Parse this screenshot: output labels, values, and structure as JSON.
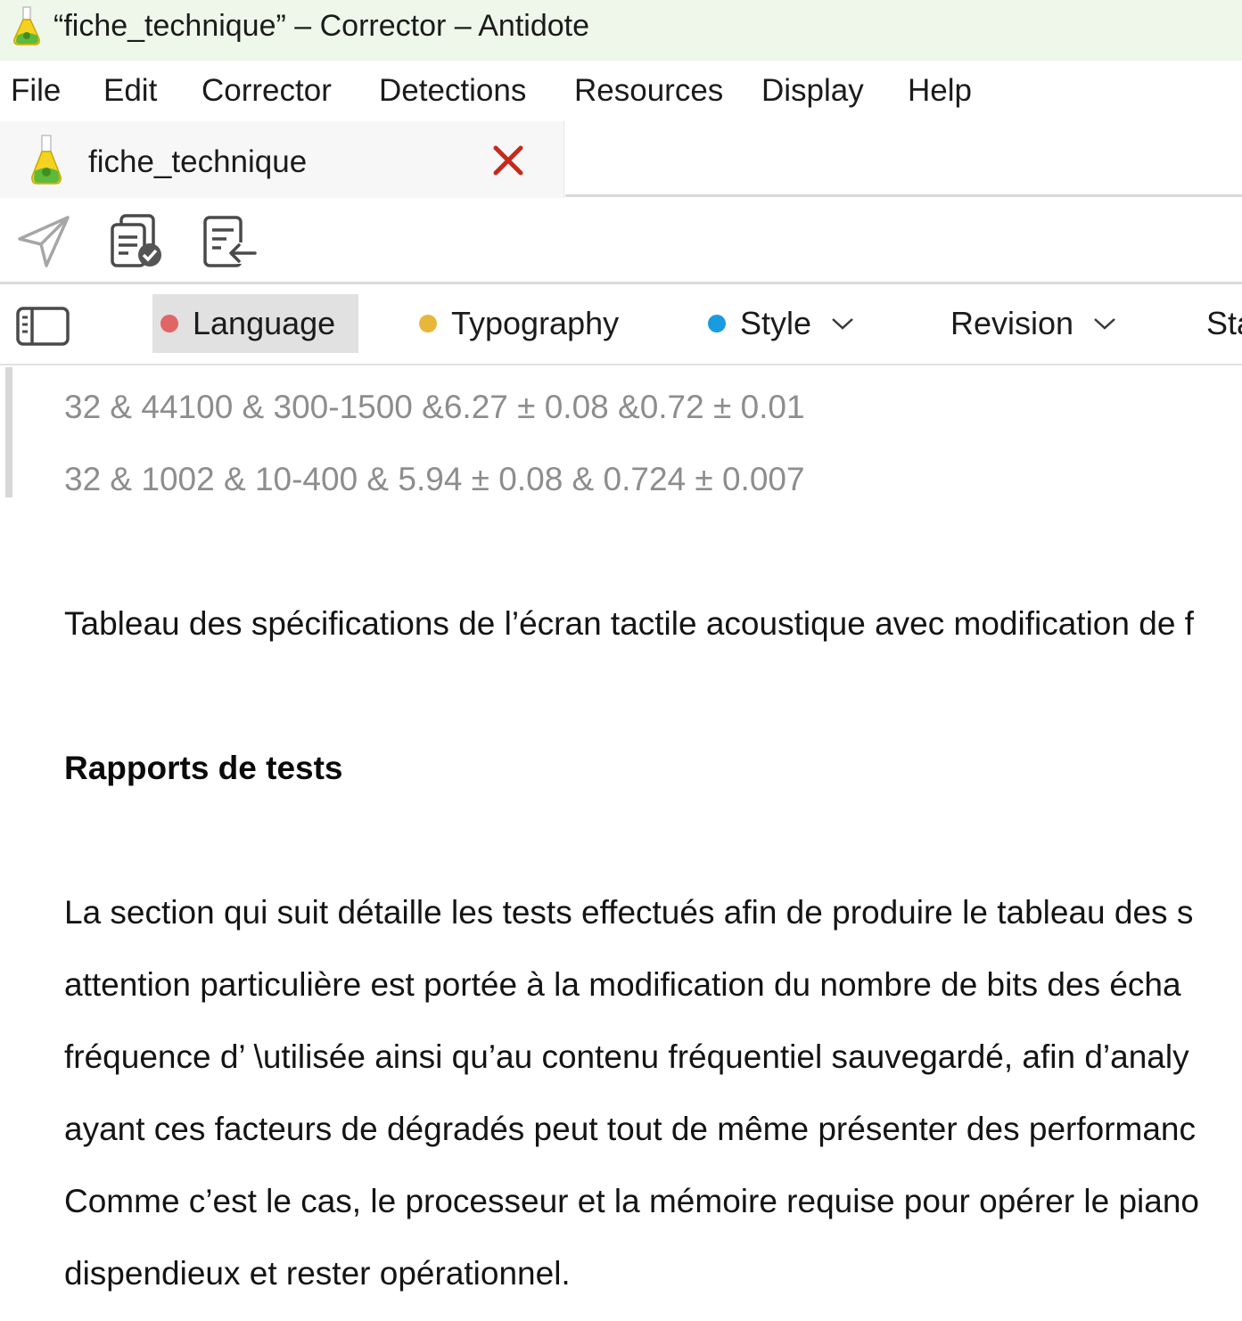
{
  "window": {
    "title": "“fiche_technique” – Corrector – Antidote"
  },
  "menu": {
    "items": [
      "File",
      "Edit",
      "Corrector",
      "Detections",
      "Resources",
      "Display",
      "Help"
    ]
  },
  "tab": {
    "label": "fiche_technique",
    "close_icon": "close-icon",
    "close_color": "#c42b1c"
  },
  "toolbar": {
    "icons": [
      "send-icon",
      "copy-check-icon",
      "import-document-icon"
    ]
  },
  "filters": {
    "items": [
      {
        "label": "Language",
        "dot_color": "#e06666",
        "active": true,
        "dropdown": false
      },
      {
        "label": "Typography",
        "dot_color": "#e8b63b",
        "active": false,
        "dropdown": false
      },
      {
        "label": "Style",
        "dot_color": "#1a9be0",
        "active": false,
        "dropdown": true
      },
      {
        "label": "Revision",
        "dot_color": "",
        "active": false,
        "dropdown": true
      },
      {
        "label": "Sta",
        "dot_color": "",
        "active": false,
        "dropdown": false
      }
    ]
  },
  "document": {
    "table_rows": [
      "32 & 44100 & 300-1500 &6.27 ± 0.08 &0.72 ± 0.01",
      "32 & 1002 & 10-400 & 5.94 ± 0.08 & 0.724 ± 0.007"
    ],
    "caption": "Tableau des spécifications de l’écran tactile acoustique avec modification de f",
    "heading": "Rapports de tests",
    "paragraph_lines": [
      "La section qui suit détaille les tests effectués afin de produire le tableau des s",
      "attention particulière est portée à la modification du nombre de bits des écha",
      "fréquence d’ \\utilisée ainsi qu’au contenu fréquentiel sauvegardé, afin d’analy",
      "ayant ces facteurs de dégradés peut tout de même présenter des performanc",
      "Comme c’est le cas, le processeur et la mémoire requise pour opérer le piano",
      "dispendieux et rester opérationnel."
    ]
  }
}
